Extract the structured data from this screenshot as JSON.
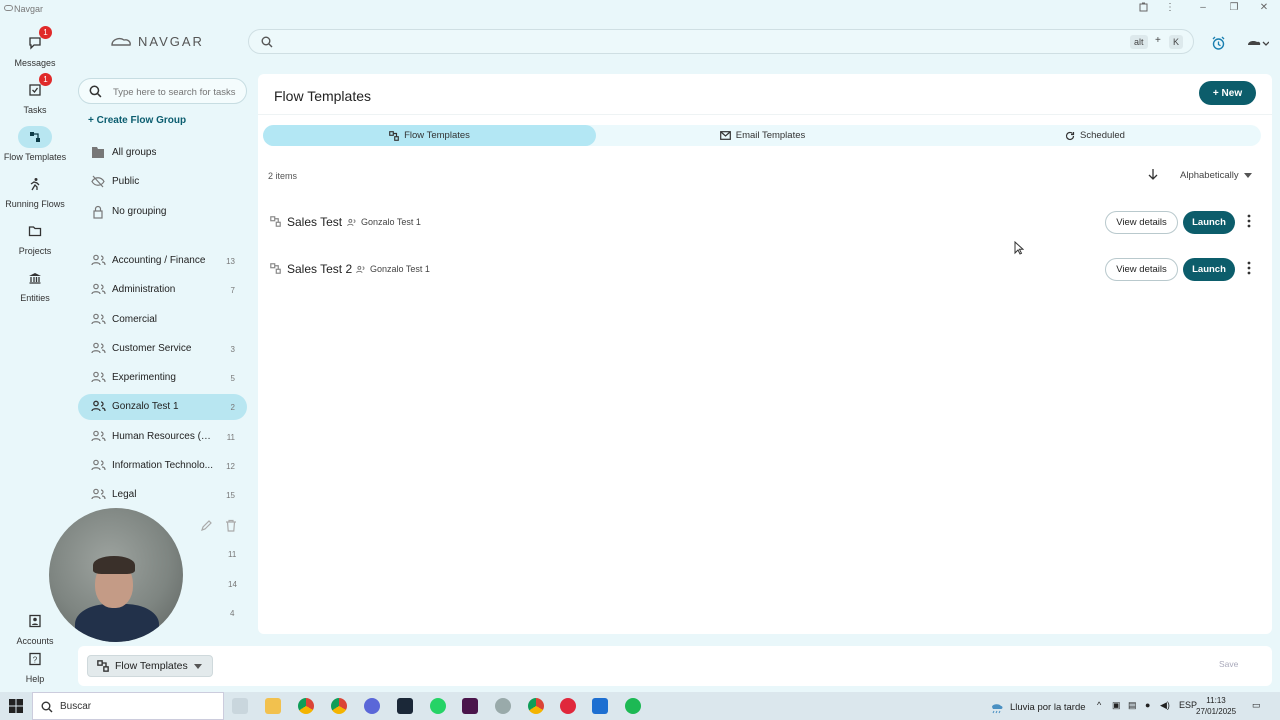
{
  "window": {
    "title": "Navgar"
  },
  "rail": {
    "items": [
      {
        "label": "Messages",
        "badge": "1"
      },
      {
        "label": "Tasks",
        "badge": "1"
      },
      {
        "label": "Flow Templates"
      },
      {
        "label": "Running Flows"
      },
      {
        "label": "Projects"
      },
      {
        "label": "Entities"
      }
    ],
    "bottom": [
      {
        "label": "Accounts"
      },
      {
        "label": "Help"
      }
    ]
  },
  "brand": {
    "name": "NAVGAR"
  },
  "search": {
    "placeholder": "",
    "shortcut_key1": "alt",
    "shortcut_plus": "+",
    "shortcut_key2": "K"
  },
  "groups_panel": {
    "search_placeholder": "Type here to search for tasks",
    "create_label": "+ Create Flow Group",
    "filters": [
      {
        "label": "All groups"
      },
      {
        "label": "Public"
      },
      {
        "label": "No grouping"
      }
    ],
    "groups": [
      {
        "name": "Accounting / Finance",
        "count": "13"
      },
      {
        "name": "Administration",
        "count": "7"
      },
      {
        "name": "Comercial",
        "count": ""
      },
      {
        "name": "Customer Service",
        "count": "3"
      },
      {
        "name": "Experimenting",
        "count": "5"
      },
      {
        "name": "Gonzalo Test 1",
        "count": "2",
        "active": true
      },
      {
        "name": "Human Resources (HR)",
        "count": "11"
      },
      {
        "name": "Information Technolo...",
        "count": "12"
      },
      {
        "name": "Legal",
        "count": "15"
      }
    ],
    "hidden_counts": [
      "11",
      "14",
      "4"
    ]
  },
  "main": {
    "title": "Flow Templates",
    "new_label": "New",
    "tabs": [
      {
        "label": "Flow Templates",
        "active": true
      },
      {
        "label": "Email Templates"
      },
      {
        "label": "Scheduled"
      }
    ],
    "items_count": "2 items",
    "sort_label": "Alphabetically",
    "templates": [
      {
        "name": "Sales Test",
        "group": "Gonzalo Test 1",
        "view_label": "View details",
        "launch_label": "Launch"
      },
      {
        "name": "Sales Test 2",
        "group": "Gonzalo Test 1",
        "view_label": "View details",
        "launch_label": "Launch"
      }
    ]
  },
  "bottom_bar": {
    "selector_label": "Flow Templates",
    "save_label": "Save"
  },
  "taskbar": {
    "search_label": "Buscar",
    "weather": "Lluvia por la tarde",
    "lang": "ESP",
    "time": "11:13",
    "date": "27/01/2025"
  },
  "colors": {
    "accent": "#0c5d6b",
    "active_bg": "#b8e6f1",
    "background": "#e9f7fa",
    "badge": "#e02a2a"
  }
}
